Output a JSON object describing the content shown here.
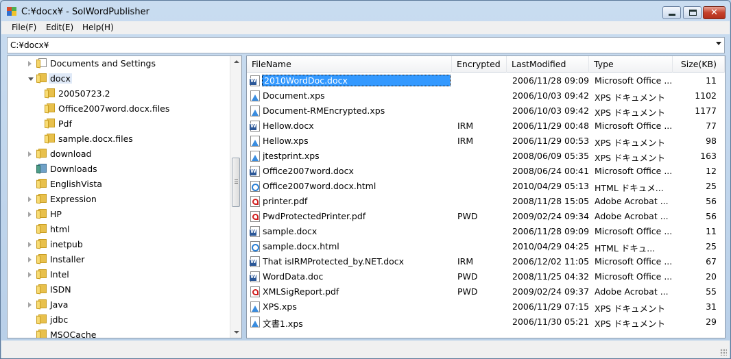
{
  "window": {
    "title": "C:¥docx¥ - SolWordPublisher",
    "controls": {
      "minimize": "minimize",
      "maximize": "maximize",
      "close": "✕"
    }
  },
  "menu": [
    {
      "label": "File(F)"
    },
    {
      "label": "Edit(E)"
    },
    {
      "label": "Help(H)"
    }
  ],
  "path": {
    "value": "C:¥docx¥"
  },
  "tree": [
    {
      "label": "Documents and Settings",
      "expander": "collapsed",
      "indent": 0,
      "icon": "docs-folder-icon"
    },
    {
      "label": "docx",
      "expander": "expanded",
      "indent": 0,
      "icon": "folder-icon",
      "selected": true
    },
    {
      "label": "20050723.2",
      "expander": "none",
      "indent": 1,
      "icon": "folder-icon"
    },
    {
      "label": "Office2007word.docx.files",
      "expander": "none",
      "indent": 1,
      "icon": "folder-icon"
    },
    {
      "label": "Pdf",
      "expander": "none",
      "indent": 1,
      "icon": "folder-icon"
    },
    {
      "label": "sample.docx.files",
      "expander": "none",
      "indent": 1,
      "icon": "folder-icon"
    },
    {
      "label": "download",
      "expander": "collapsed",
      "indent": 0,
      "icon": "folder-icon"
    },
    {
      "label": "Downloads",
      "expander": "none",
      "indent": 0,
      "icon": "special-folder-icon"
    },
    {
      "label": "EnglishVista",
      "expander": "none",
      "indent": 0,
      "icon": "folder-icon"
    },
    {
      "label": "Expression",
      "expander": "collapsed",
      "indent": 0,
      "icon": "folder-icon"
    },
    {
      "label": "HP",
      "expander": "collapsed",
      "indent": 0,
      "icon": "folder-icon"
    },
    {
      "label": "html",
      "expander": "none",
      "indent": 0,
      "icon": "folder-icon"
    },
    {
      "label": "inetpub",
      "expander": "collapsed",
      "indent": 0,
      "icon": "folder-icon"
    },
    {
      "label": "Installer",
      "expander": "collapsed",
      "indent": 0,
      "icon": "folder-icon"
    },
    {
      "label": "Intel",
      "expander": "collapsed",
      "indent": 0,
      "icon": "folder-icon"
    },
    {
      "label": "ISDN",
      "expander": "none",
      "indent": 0,
      "icon": "folder-icon"
    },
    {
      "label": "Java",
      "expander": "collapsed",
      "indent": 0,
      "icon": "folder-icon"
    },
    {
      "label": "jdbc",
      "expander": "none",
      "indent": 0,
      "icon": "folder-icon"
    },
    {
      "label": "MSOCache",
      "expander": "none",
      "indent": 0,
      "icon": "folder-icon"
    }
  ],
  "grid": {
    "columns": [
      {
        "label": "FileName"
      },
      {
        "label": "Encrypted"
      },
      {
        "label": "LastModified"
      },
      {
        "label": "Type"
      },
      {
        "label": "Size(KB)"
      }
    ],
    "rows": [
      {
        "icon": "word-doc-icon",
        "name": "2010WordDoc.docx",
        "enc": "",
        "mod": "2006/11/28 09:09",
        "type": "Microsoft Office ...",
        "size": "11",
        "selected": true
      },
      {
        "icon": "xps-doc-icon",
        "name": "Document.xps",
        "enc": "",
        "mod": "2006/10/03 09:42",
        "type": "XPS ドキュメント",
        "size": "1102"
      },
      {
        "icon": "xps-doc-icon",
        "name": "Document-RMEncrypted.xps",
        "enc": "",
        "mod": "2006/10/03 09:42",
        "type": "XPS ドキュメント",
        "size": "1177"
      },
      {
        "icon": "word-doc-icon",
        "name": "Hellow.docx",
        "enc": "IRM",
        "mod": "2006/11/29 00:48",
        "type": "Microsoft Office ...",
        "size": "77"
      },
      {
        "icon": "xps-doc-icon",
        "name": "Hellow.xps",
        "enc": "IRM",
        "mod": "2006/11/29 00:53",
        "type": "XPS ドキュメント",
        "size": "98"
      },
      {
        "icon": "xps-doc-icon",
        "name": "jtestprint.xps",
        "enc": "",
        "mod": "2008/06/09 05:35",
        "type": "XPS ドキュメント",
        "size": "163"
      },
      {
        "icon": "word-doc-icon",
        "name": "Office2007word.docx",
        "enc": "",
        "mod": "2008/06/24 00:41",
        "type": "Microsoft Office ...",
        "size": "12"
      },
      {
        "icon": "html-doc-icon",
        "name": "Office2007word.docx.html",
        "enc": "",
        "mod": "2010/04/29 05:13",
        "type": "HTML ドキュメ...",
        "size": "25"
      },
      {
        "icon": "pdf-doc-icon",
        "name": "printer.pdf",
        "enc": "",
        "mod": "2008/11/28 15:05",
        "type": "Adobe Acrobat ...",
        "size": "56"
      },
      {
        "icon": "pdf-doc-icon",
        "name": "PwdProtectedPrinter.pdf",
        "enc": "PWD",
        "mod": "2009/02/24 09:34",
        "type": "Adobe Acrobat ...",
        "size": "56"
      },
      {
        "icon": "word-doc-icon",
        "name": "sample.docx",
        "enc": "",
        "mod": "2006/11/28 09:09",
        "type": "Microsoft Office ...",
        "size": "11"
      },
      {
        "icon": "html-doc-icon",
        "name": "sample.docx.html",
        "enc": "",
        "mod": "2010/04/29 04:25",
        "type": "HTML ドキュ...",
        "size": "25"
      },
      {
        "icon": "word-doc-icon",
        "name": "That isIRMProtected_by.NET.docx",
        "enc": "IRM",
        "mod": "2006/12/02 11:05",
        "type": "Microsoft Office ...",
        "size": "67"
      },
      {
        "icon": "word-doc-icon",
        "name": "WordData.doc",
        "enc": "PWD",
        "mod": "2008/11/25 04:32",
        "type": "Microsoft Office ...",
        "size": "20"
      },
      {
        "icon": "pdf-doc-icon",
        "name": "XMLSigReport.pdf",
        "enc": "PWD",
        "mod": "2009/02/24 09:37",
        "type": "Adobe Acrobat ...",
        "size": "55"
      },
      {
        "icon": "xps-doc-icon",
        "name": "XPS.xps",
        "enc": "",
        "mod": "2006/11/29 07:15",
        "type": "XPS ドキュメント",
        "size": "31"
      },
      {
        "icon": "xps-doc-icon",
        "name": "文書1.xps",
        "enc": "",
        "mod": "2006/11/30 05:21",
        "type": "XPS ドキュメント",
        "size": "29"
      }
    ]
  },
  "colors": {
    "selection": "#3399ff",
    "tree_selection": "#dfe9f7",
    "window_frame": "#b8cfe8"
  }
}
